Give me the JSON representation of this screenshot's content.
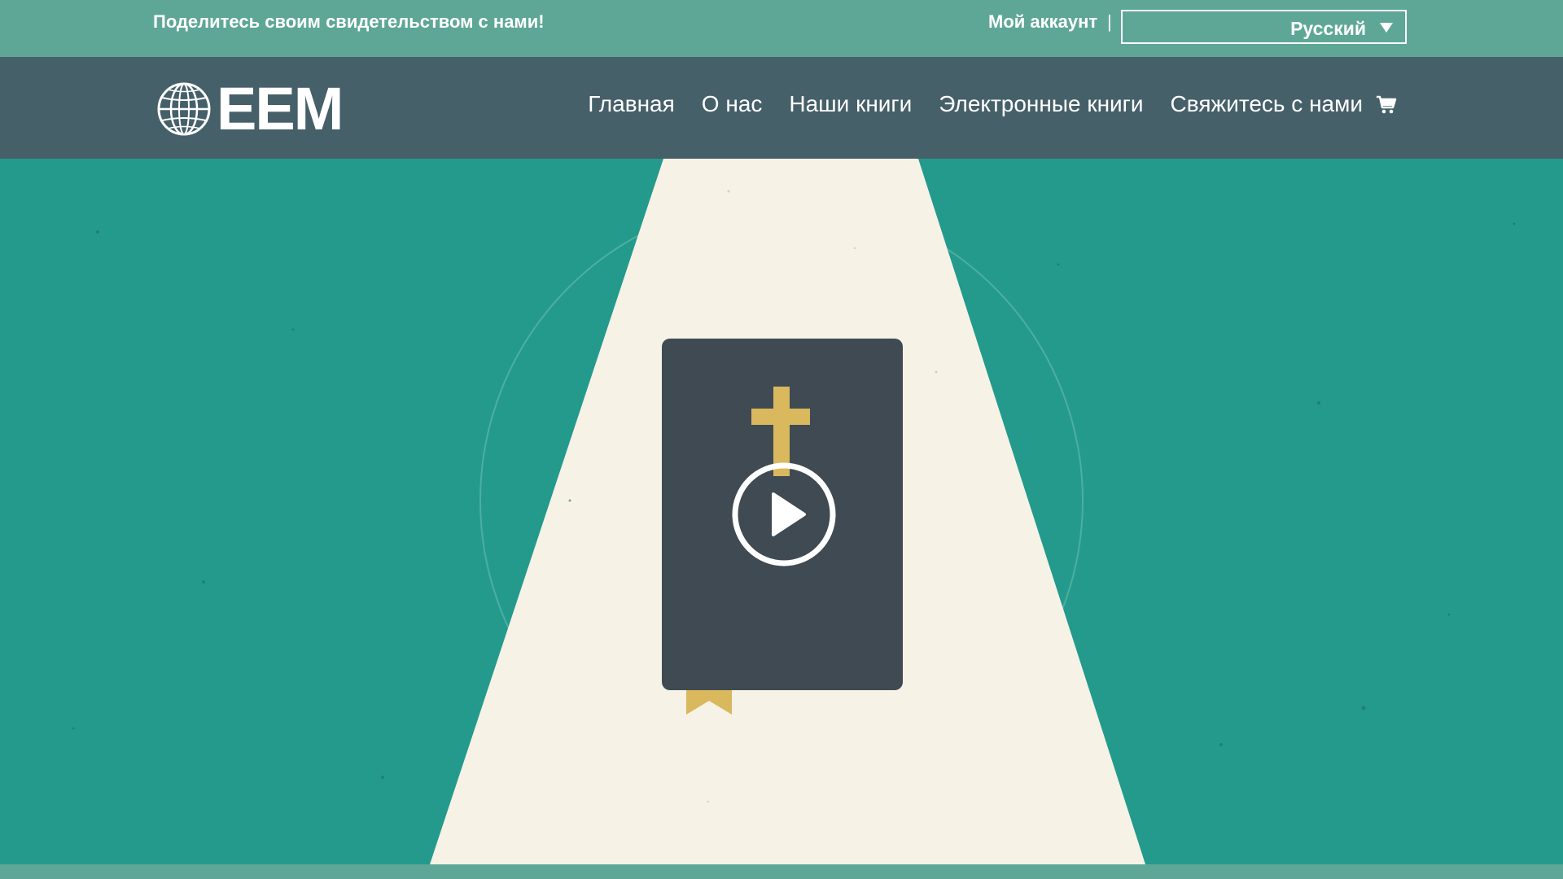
{
  "topbar": {
    "share_text": "Поделитесь своим свидетельством с нами!",
    "account_label": "Мой аккаунт",
    "separator": "|",
    "language": {
      "selected": "Русский"
    }
  },
  "navbar": {
    "logo_text": "EEM",
    "items": [
      {
        "label": "Главная"
      },
      {
        "label": "О нас"
      },
      {
        "label": "Наши книги"
      },
      {
        "label": "Электронные книги"
      },
      {
        "label": "Свяжитесь с нами"
      }
    ],
    "cart_icon": "cart-icon"
  },
  "hero": {
    "media": "video",
    "play_icon": "play-icon",
    "illustration": "bible-with-cross"
  },
  "colors": {
    "topbar_bg": "#5ea797",
    "navbar_bg": "#46606a",
    "hero_bg": "#249a8d",
    "beam": "#f6f2e6",
    "book": "#3f4a53",
    "cross": "#d9b85e"
  }
}
